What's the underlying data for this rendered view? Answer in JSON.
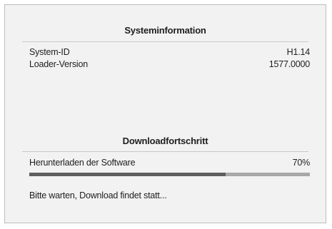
{
  "system_info": {
    "title": "Systeminformation",
    "rows": [
      {
        "label": "System-ID",
        "value": "H1.14"
      },
      {
        "label": "Loader-Version",
        "value": "1577.0000"
      }
    ]
  },
  "download": {
    "title": "Downloadfortschritt",
    "task_label": "Herunterladen der Software",
    "percent_text": "70%",
    "progress_fraction": 0.7,
    "status_text": "Bitte warten, Download findet statt..."
  },
  "colors": {
    "panel_background": "#f2f2f2",
    "progress_track": "#a8a8a8",
    "progress_fill": "#5e5e5e",
    "text": "#1e1e1e"
  }
}
